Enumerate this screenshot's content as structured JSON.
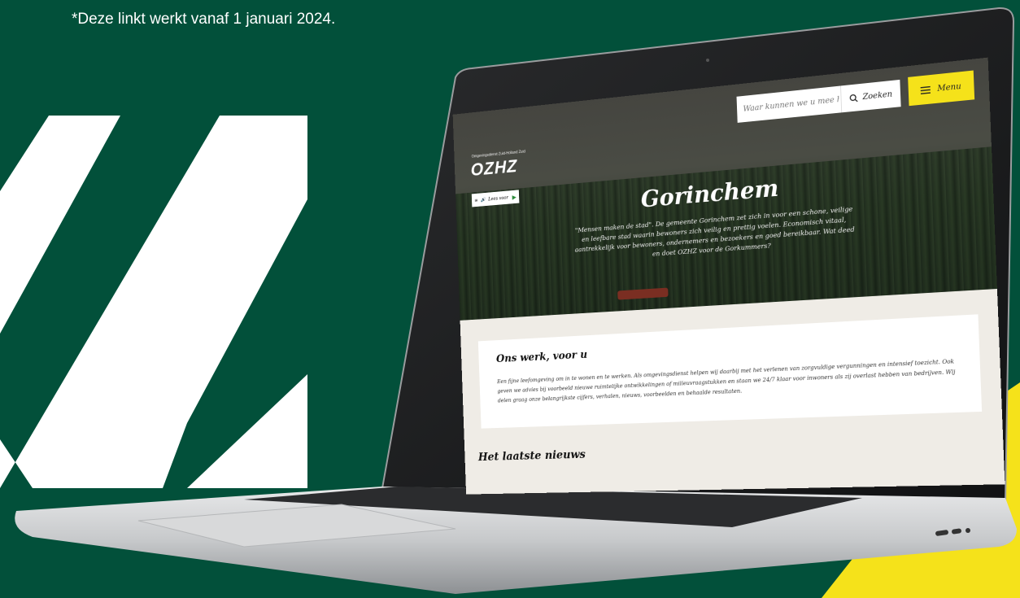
{
  "caption": "*Deze linkt werkt vanaf 1 januari 2024.",
  "site": {
    "search_placeholder": "Waar kunnen we u mee helpen?",
    "search_button": "Zoeken",
    "menu_button": "Menu",
    "logo_subtitle": "Omgevingsdienst Zuid-Holland Zuid",
    "logo_text": "OZHZ",
    "read_aloud": "Lees voor",
    "hero_title": "Gorinchem",
    "hero_text": "\"Mensen maken de stad\". De gemeente Gorinchem zet zich in voor een schone, veilige en leefbare stad waarin bewoners zich veilig en prettig voelen. Economisch vitaal, aantrekkelijk voor bewoners, ondernemers en bezoekers en goed bereikbaar. Wat deed en doet OZHZ voor de Gorkummers?",
    "section_title": "Ons werk, voor u",
    "section_text": "Een fijne leefomgeving om in te wonen en te werken. Als omgevingsdienst helpen wij daarbij met het verlenen van zorgvuldige vergunningen en intensief toezicht. Ook geven we advies bij voorbeeld nieuwe ruimtelijke ontwikkelingen of milieuvraagstukken en staan we 24/7 klaar voor inwoners als zij overlast hebben van bedrijven. Wij delen graag onze belangrijkste cijfers, verhalen, nieuws, voorbeelden en behaalde resultaten.",
    "news_title": "Het laatste nieuws"
  },
  "colors": {
    "background": "#02503a",
    "accent_yellow": "#f5e21a",
    "laptop_silver": "#c9cbcd"
  }
}
